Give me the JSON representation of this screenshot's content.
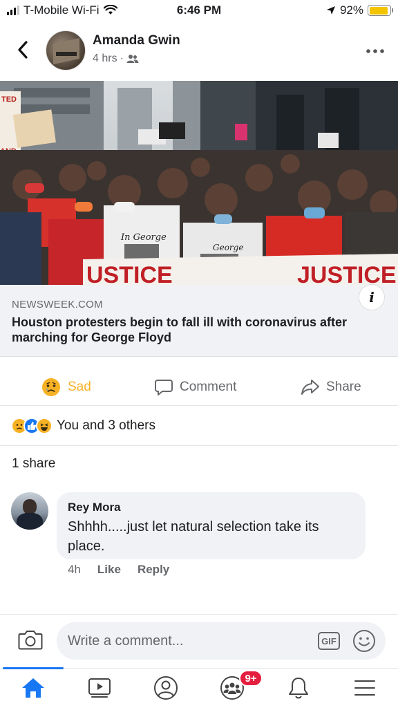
{
  "status_bar": {
    "carrier": "T-Mobile Wi-Fi",
    "time": "6:46 PM",
    "battery": "92%",
    "battery_level": 0.92
  },
  "post": {
    "author": "Amanda Gwin",
    "time_ago": "4 hrs",
    "separator": "·",
    "audience_icon": "friends-icon",
    "image_sign_text": [
      "TED",
      "AND",
      "JUSTICE",
      "In George",
      "George"
    ]
  },
  "link_preview": {
    "domain": "NEWSWEEK.COM",
    "title": "Houston protesters begin to fall ill with coronavirus after marching for George Floyd",
    "info_label": "i"
  },
  "actions": {
    "sad_label": "Sad",
    "comment_label": "Comment",
    "share_label": "Share"
  },
  "reactions": {
    "icons": [
      "sad-icon",
      "like-icon",
      "haha-icon"
    ],
    "summary": "You and 3 others"
  },
  "shares": {
    "label": "1 share"
  },
  "comment": {
    "author": "Rey Mora",
    "text": "Shhhh.....just let natural selection take its place.",
    "time": "4h",
    "like_label": "Like",
    "reply_label": "Reply"
  },
  "composer": {
    "placeholder": "Write a comment...",
    "gif_label": "GIF"
  },
  "bottom_nav": {
    "items": [
      "home-icon",
      "watch-icon",
      "profile-icon",
      "groups-icon",
      "notifications-icon",
      "menu-icon"
    ],
    "groups_badge": "9+",
    "active": "home-icon"
  },
  "colors": {
    "facebook_blue": "#1877f2",
    "sad_yellow": "#f7b125",
    "badge_red": "#e41e3f",
    "muted_text": "#65676b",
    "bubble_bg": "#f0f2f5"
  }
}
